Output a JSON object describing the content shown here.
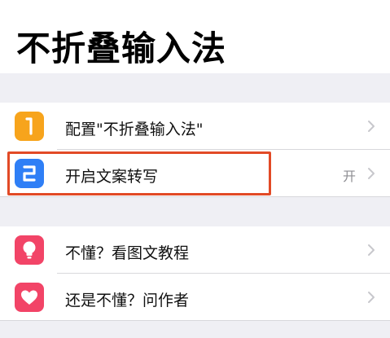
{
  "page": {
    "title": "不折叠输入法"
  },
  "groups": [
    {
      "items": [
        {
          "icon": "digit-1-icon",
          "label": "配置\"不折叠输入法\"",
          "value": ""
        },
        {
          "icon": "digit-2-icon",
          "label": "开启文案转写",
          "value": "开"
        }
      ]
    },
    {
      "items": [
        {
          "icon": "lightbulb-icon",
          "label": "不懂？看图文教程",
          "value": ""
        },
        {
          "icon": "heart-icon",
          "label": "还是不懂？问作者",
          "value": ""
        }
      ]
    }
  ],
  "colors": {
    "background": "#efeff4",
    "icon_orange": "#f7a41c",
    "icon_blue": "#2f7ff6",
    "icon_red": "#f24467",
    "highlight": "#e24a26",
    "chevron": "#c7c7cc"
  }
}
